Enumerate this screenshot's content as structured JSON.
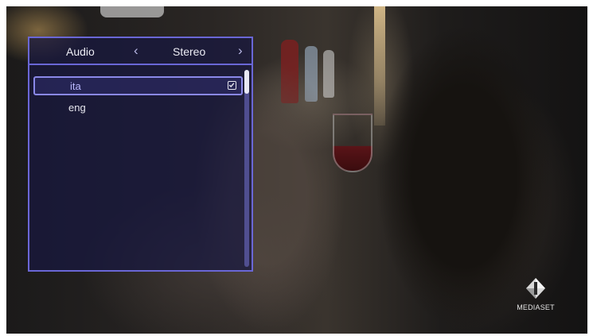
{
  "menu": {
    "title": "Audio",
    "prev_arrow": "‹",
    "value": "Stereo",
    "next_arrow": "›",
    "tracks": [
      {
        "label": "ita",
        "selected": true,
        "checked": true
      },
      {
        "label": "eng",
        "selected": false,
        "checked": false
      }
    ],
    "scroll_position": 0.0,
    "border_color": "#6a67d6"
  },
  "channel_logo": {
    "text": "MEDIASET"
  }
}
